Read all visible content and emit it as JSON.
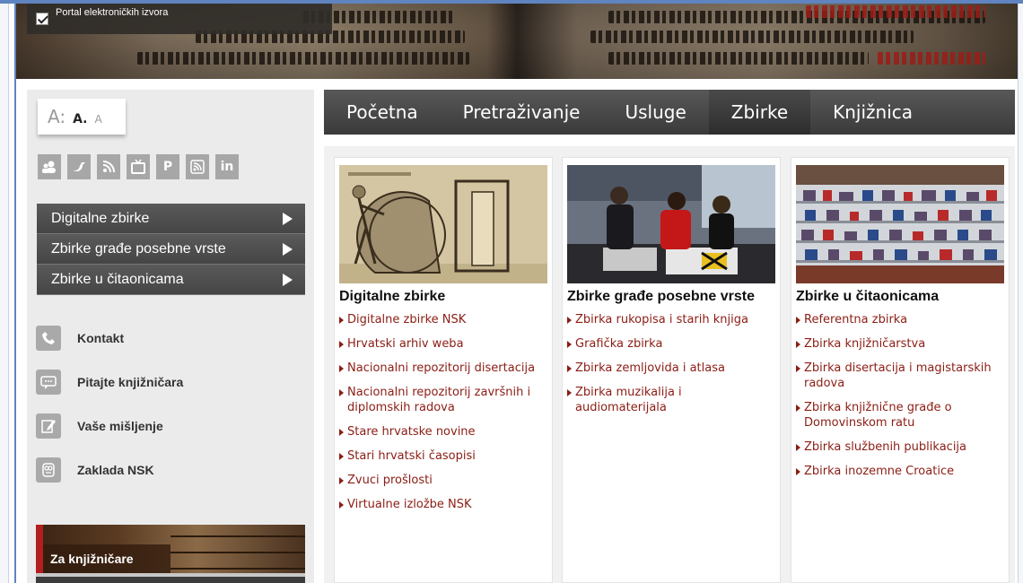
{
  "portal": {
    "label": "Portal elektroničkih izvora",
    "checked": true
  },
  "font_size": {
    "large": "A:",
    "medium": "A.",
    "small": "A"
  },
  "social_icons": [
    "people-icon",
    "twitter-bird-icon",
    "podcast-icon",
    "tv-icon",
    "pinterest-icon",
    "rss-icon",
    "linkedin-icon"
  ],
  "social_labels": {
    "pinterest": "P",
    "linkedin": "in"
  },
  "categories": [
    {
      "label": "Digitalne zbirke"
    },
    {
      "label": "Zbirke građe posebne vrste"
    },
    {
      "label": "Zbirke u čitaonicama"
    }
  ],
  "links": [
    {
      "label": "Kontakt",
      "icon": "phone-icon"
    },
    {
      "label": "Pitajte knjižničara",
      "icon": "chat-bubble-icon"
    },
    {
      "label": "Vaše mišljenje",
      "icon": "note-pen-icon"
    },
    {
      "label": "Zaklada NSK",
      "icon": "owl-icon"
    }
  ],
  "promo": {
    "label": "Za knjižničare"
  },
  "nav": {
    "tabs": [
      "Početna",
      "Pretraživanje",
      "Usluge",
      "Zbirke",
      "Knjižnica"
    ],
    "active": "Zbirke"
  },
  "columns": [
    {
      "title": "Digitalne zbirke",
      "items": [
        "Digitalne zbirke NSK",
        "Hrvatski arhiv weba",
        "Nacionalni repozitorij disertacija",
        "Nacionalni repozitorij završnih i diplomskih radova",
        "Stare hrvatske novine",
        "Stari hrvatski časopisi",
        "Zvuci prošlosti",
        "Virtualne izložbe NSK"
      ]
    },
    {
      "title": "Zbirke građe posebne vrste",
      "items": [
        "Zbirka rukopisa i starih knjiga",
        "Grafička zbirka",
        "Zbirka zemljovida i atlasa",
        "Zbirka muzikalija i audiomaterijala"
      ]
    },
    {
      "title": "Zbirke u čitaonicama",
      "items": [
        "Referentna zbirka",
        "Zbirka knjižničarstva",
        "Zbirka disertacija i magistarskih radova",
        "Zbirka knjižnične građe o Domovinskom ratu",
        "Zbirka službenih publikacija",
        "Zbirka inozemne Croatice"
      ]
    }
  ],
  "colors": {
    "nav_dark": "#3a3a3a",
    "link": "#8b1d14",
    "sidebar": "#ebebeb",
    "accent_red": "#b31e1e"
  }
}
